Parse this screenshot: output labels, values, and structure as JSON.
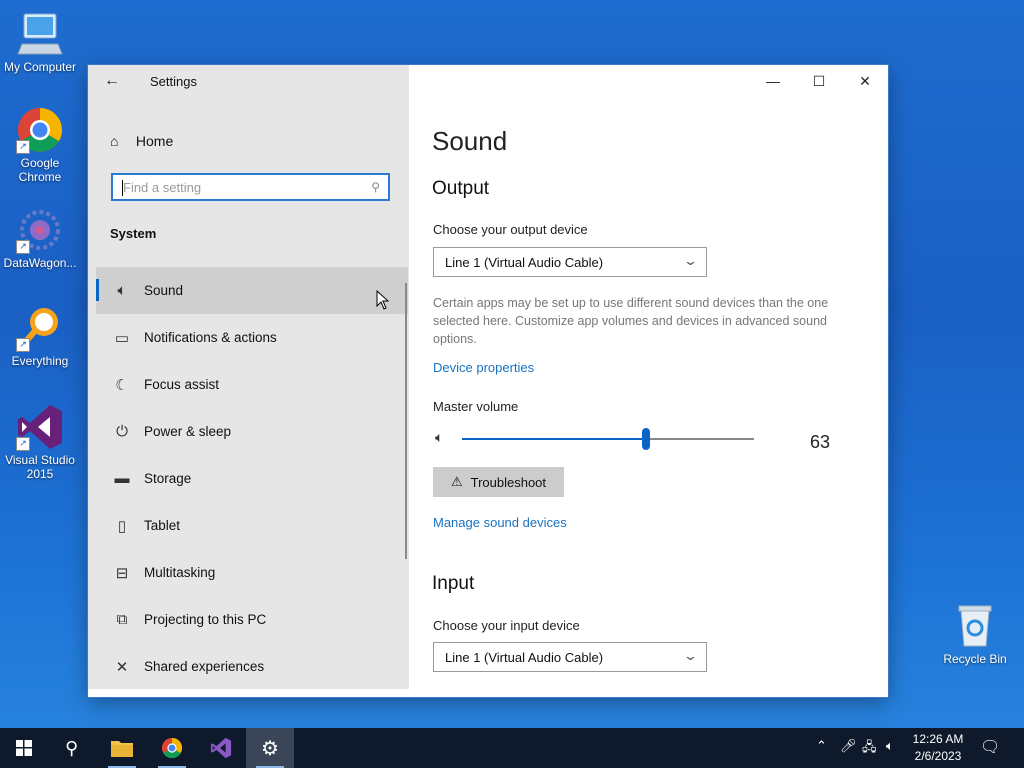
{
  "desktop": {
    "icons": [
      {
        "label": "My Computer"
      },
      {
        "label": "Google Chrome"
      },
      {
        "label": "DataWagon..."
      },
      {
        "label": "Everything"
      },
      {
        "label": "Visual Studio 2015"
      },
      {
        "label": "Recycle Bin"
      }
    ]
  },
  "window": {
    "title": "Settings",
    "back": "←",
    "controls": {
      "minimize": "—",
      "maximize": "☐",
      "close": "✕"
    }
  },
  "sidebar": {
    "home_label": "Home",
    "search_placeholder": "Find a setting",
    "section_title": "System",
    "items": [
      {
        "label": "Sound",
        "icon": "speaker-icon",
        "active": true
      },
      {
        "label": "Notifications & actions",
        "icon": "notifications-icon"
      },
      {
        "label": "Focus assist",
        "icon": "moon-icon"
      },
      {
        "label": "Power & sleep",
        "icon": "power-icon"
      },
      {
        "label": "Storage",
        "icon": "storage-icon"
      },
      {
        "label": "Tablet",
        "icon": "tablet-icon"
      },
      {
        "label": "Multitasking",
        "icon": "multitasking-icon"
      },
      {
        "label": "Projecting to this PC",
        "icon": "projecting-icon"
      },
      {
        "label": "Shared experiences",
        "icon": "shared-experiences-icon"
      }
    ]
  },
  "main": {
    "title": "Sound",
    "output": {
      "heading": "Output",
      "device_label": "Choose your output device",
      "device_value": "Line 1 (Virtual Audio Cable)",
      "description": "Certain apps may be set up to use different sound devices than the one selected here. Customize app volumes and devices in advanced sound options.",
      "device_properties_link": "Device properties",
      "volume_label": "Master volume",
      "volume_value": "63",
      "volume_level": 63,
      "troubleshoot_label": "Troubleshoot",
      "manage_link": "Manage sound devices"
    },
    "input": {
      "heading": "Input",
      "device_label": "Choose your input device",
      "device_value": "Line 1 (Virtual Audio Cable)"
    }
  },
  "taskbar": {
    "time": "12:26 AM",
    "date": "2/6/2023"
  },
  "colors": {
    "accent": "#0a64c8",
    "link": "#1a73c4",
    "desktop": "#1a5fc4",
    "taskbar": "#0e1a2b"
  }
}
